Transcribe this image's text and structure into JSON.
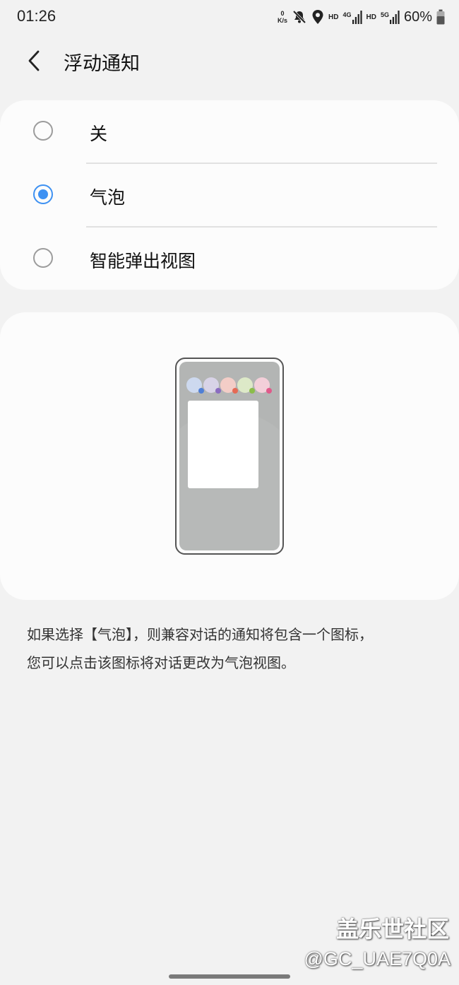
{
  "status_bar": {
    "time": "01:26",
    "net_speed_value": "0",
    "net_speed_unit": "K/s",
    "hd_label_1": "HD",
    "network_1": "4G",
    "hd_label_2": "HD",
    "network_2": "5G",
    "battery": "60%",
    "icons": [
      "mute-icon",
      "location-icon",
      "signal-icon",
      "signal-icon",
      "battery-icon"
    ]
  },
  "header": {
    "title": "浮动通知",
    "back_icon": "chevron-left-icon"
  },
  "options": [
    {
      "label": "关",
      "checked": false
    },
    {
      "label": "气泡",
      "checked": true
    },
    {
      "label": "智能弹出视图",
      "checked": false
    }
  ],
  "illustration": {
    "bubbles": [
      {
        "color": "#cdd9ef",
        "dot": "#4f7fd6"
      },
      {
        "color": "#d8d3e7",
        "dot": "#8a6cc0"
      },
      {
        "color": "#f3cdc7",
        "dot": "#e56a55"
      },
      {
        "color": "#dde9c8",
        "dot": "#8bbd4a"
      },
      {
        "color": "#f3cfd9",
        "dot": "#e05a8a"
      }
    ]
  },
  "description": {
    "line1": "如果选择【气泡】，则兼容对话的通知将包含一个图标，",
    "line2": "您可以点击该图标将对话更改为气泡视图。"
  },
  "watermark": {
    "title": "盖乐世社区",
    "user": "@GC_UAE7Q0A"
  },
  "colors": {
    "accent": "#3e91f2",
    "background": "#f2f2f2",
    "card": "#fcfcfc"
  }
}
